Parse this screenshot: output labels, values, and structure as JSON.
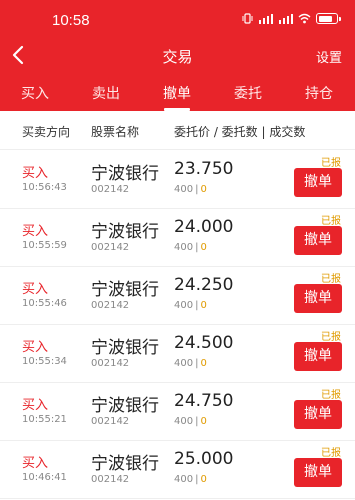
{
  "status_bar": {
    "time": "10:58"
  },
  "header": {
    "title": "交易",
    "settings_label": "设置"
  },
  "tabs": [
    {
      "label": "买入",
      "active": false
    },
    {
      "label": "卖出",
      "active": false
    },
    {
      "label": "撤单",
      "active": true
    },
    {
      "label": "委托",
      "active": false
    },
    {
      "label": "持仓",
      "active": false
    }
  ],
  "columns": {
    "direction": "买卖方向",
    "stock": "股票名称",
    "price_qty": "委托价 / 委托数 | 成交数"
  },
  "orders": [
    {
      "type": "买入",
      "time": "10:56:43",
      "name": "宁波银行",
      "code": "002142",
      "price": "23.750",
      "qty": "400",
      "filled": "0",
      "status": "已报",
      "action": "撤单"
    },
    {
      "type": "买入",
      "time": "10:55:59",
      "name": "宁波银行",
      "code": "002142",
      "price": "24.000",
      "qty": "400",
      "filled": "0",
      "status": "已报",
      "action": "撤单"
    },
    {
      "type": "买入",
      "time": "10:55:46",
      "name": "宁波银行",
      "code": "002142",
      "price": "24.250",
      "qty": "400",
      "filled": "0",
      "status": "已报",
      "action": "撤单"
    },
    {
      "type": "买入",
      "time": "10:55:34",
      "name": "宁波银行",
      "code": "002142",
      "price": "24.500",
      "qty": "400",
      "filled": "0",
      "status": "已报",
      "action": "撤单"
    },
    {
      "type": "买入",
      "time": "10:55:21",
      "name": "宁波银行",
      "code": "002142",
      "price": "24.750",
      "qty": "400",
      "filled": "0",
      "status": "已报",
      "action": "撤单"
    },
    {
      "type": "买入",
      "time": "10:46:41",
      "name": "宁波银行",
      "code": "002142",
      "price": "25.000",
      "qty": "400",
      "filled": "0",
      "status": "已报",
      "action": "撤单"
    }
  ],
  "colors": {
    "brand_red": "#e8242a",
    "status_orange": "#e09b00"
  },
  "icons": [
    "back-arrow-icon",
    "vibrate-icon",
    "signal-4g-icon",
    "signal-5g-icon",
    "wifi-icon",
    "battery-icon"
  ]
}
